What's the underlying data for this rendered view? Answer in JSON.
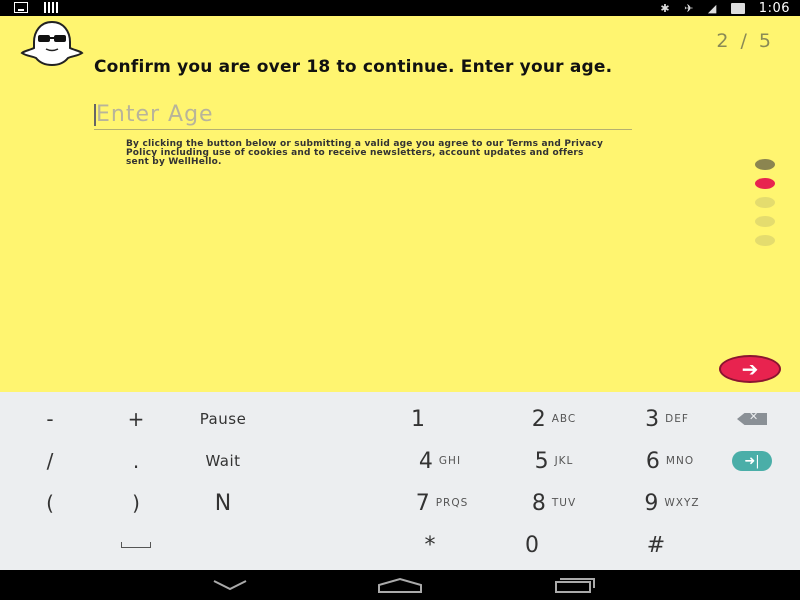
{
  "status_bar": {
    "time": "1:06",
    "left_icons": [
      "download-icon",
      "signal-bars-icon"
    ],
    "right_icons": [
      "bluetooth-icon",
      "mute-icon",
      "wifi-icon",
      "battery-icon"
    ]
  },
  "header": {
    "logo_icon": "ghost-sunglasses-icon",
    "step_counter": "2 / 5"
  },
  "form": {
    "heading": "Confirm you are over 18 to continue. Enter your age.",
    "age_input": {
      "value": "",
      "placeholder": "Enter Age"
    },
    "disclaimer": "By clicking the button below or submitting a valid age you agree to our Terms and Privacy Policy including use of cookies and to receive newsletters, account updates and offers sent by WellHello."
  },
  "progress": {
    "total_steps": 5,
    "current_step": 2
  },
  "next_button": {
    "icon": "arrow-right-icon"
  },
  "keyboard": {
    "rows": [
      [
        {
          "label": "-",
          "sub": ""
        },
        {
          "label": "+",
          "sub": ""
        },
        {
          "label": "Pause",
          "sub": ""
        },
        {
          "label": "1",
          "sub": ""
        },
        {
          "label": "2",
          "sub": "ABC"
        },
        {
          "label": "3",
          "sub": "DEF"
        },
        {
          "label": "",
          "sub": "",
          "icon": "backspace-icon"
        }
      ],
      [
        {
          "label": "/",
          "sub": ""
        },
        {
          "label": ".",
          "sub": ""
        },
        {
          "label": "Wait",
          "sub": ""
        },
        {
          "label": "4",
          "sub": "GHI"
        },
        {
          "label": "5",
          "sub": "JKL"
        },
        {
          "label": "6",
          "sub": "MNO"
        },
        {
          "label": "",
          "sub": "",
          "icon": "enter-next-icon"
        }
      ],
      [
        {
          "label": "(",
          "sub": ""
        },
        {
          "label": ")",
          "sub": ""
        },
        {
          "label": "N",
          "sub": ""
        },
        {
          "label": "7",
          "sub": "PRQS"
        },
        {
          "label": "8",
          "sub": "TUV"
        },
        {
          "label": "9",
          "sub": "WXYZ"
        }
      ],
      [
        {
          "label": "",
          "sub": "",
          "icon": "space-icon"
        },
        {
          "label": "*",
          "sub": ""
        },
        {
          "label": "0",
          "sub": ""
        },
        {
          "label": "#",
          "sub": ""
        }
      ]
    ]
  },
  "nav_bar": {
    "buttons": [
      "back-chevron-icon",
      "home-icon",
      "recents-icon"
    ]
  },
  "colors": {
    "background": "#fff570",
    "accent": "#e8234f",
    "enter_key": "#4aaea8",
    "keyboard_bg": "#eceef0"
  }
}
